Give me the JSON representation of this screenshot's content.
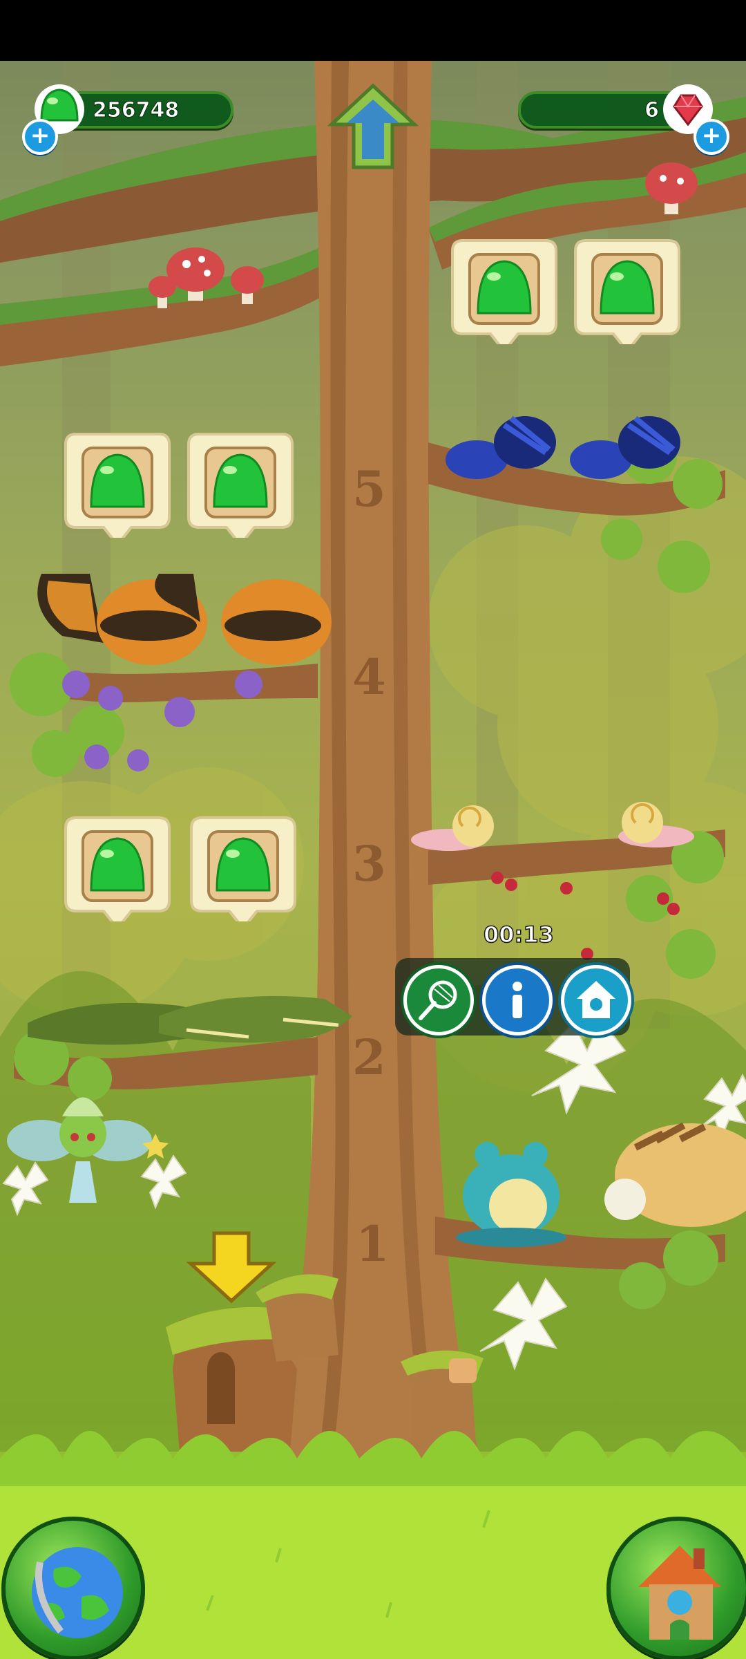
{
  "hud": {
    "gum_count": "256748",
    "gem_count": "6"
  },
  "tree": {
    "levels": [
      "1",
      "2",
      "3",
      "4",
      "5"
    ]
  },
  "nest_actions": {
    "timer": "00:13",
    "buttons": [
      "net-icon",
      "info-icon",
      "house-icon"
    ]
  },
  "colors": {
    "gum_green": "#22c23a",
    "hud_bar": "#0f5a1c",
    "plus_blue": "#1d9be0",
    "grass": "#9ad637"
  }
}
